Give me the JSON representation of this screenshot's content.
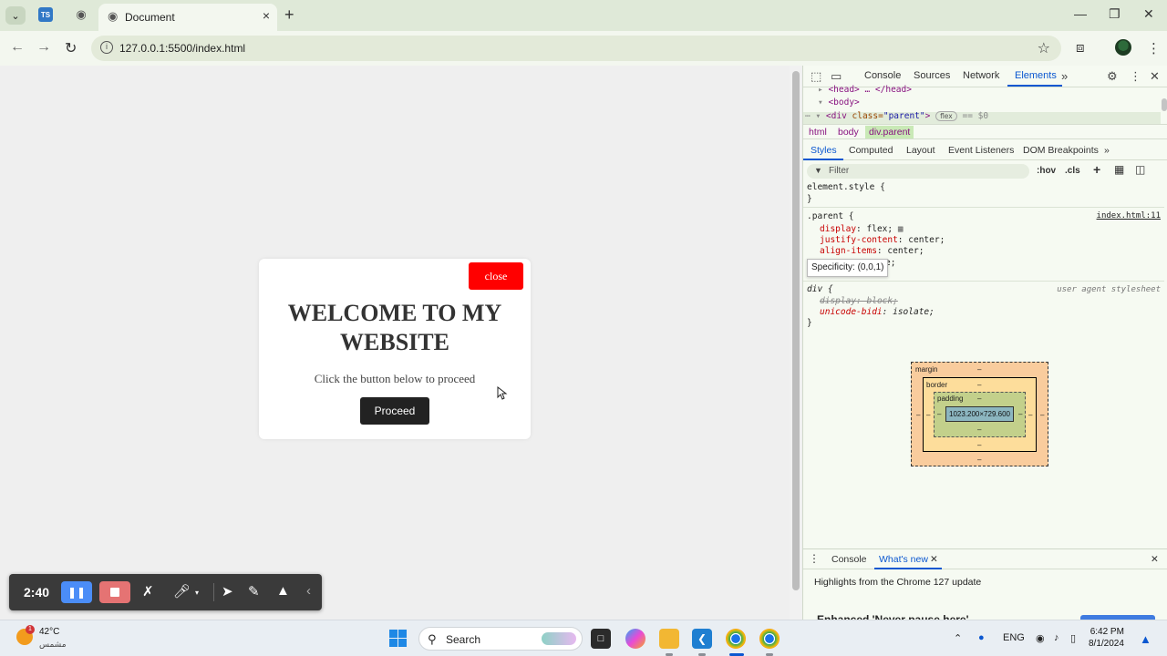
{
  "browser": {
    "tab_title": "Document",
    "url": "127.0.0.1:5500/index.html",
    "pinned_ts_label": "TS",
    "icons": {
      "tab_search": "chevron-down-icon",
      "close": "close-icon",
      "new_tab": "plus-icon"
    }
  },
  "page": {
    "close_label": "close",
    "heading": "WELCOME TO MY WEBSITE",
    "subtext": "Click the button below to proceed",
    "proceed_label": "Proceed",
    "colors": {
      "close_bg": "#ff0000",
      "proceed_bg": "#222222",
      "viewport_bg": "#efefef"
    }
  },
  "recorder": {
    "time": "2:40",
    "icons": [
      "pause-icon",
      "stop-icon",
      "pen-off-icon",
      "mic-icon",
      "pointer-icon",
      "pencil-icon",
      "eraser-icon",
      "chevron-left-icon"
    ]
  },
  "devtools": {
    "tabs": [
      "Console",
      "Sources",
      "Network",
      "Elements"
    ],
    "active_tab": "Elements",
    "dom": {
      "head_line": "<head> … </head>",
      "body_line": "<body>",
      "div_tag_open": "<div ",
      "div_attr": "class=",
      "div_val": "\"parent\"",
      "div_close": ">",
      "flex_badge": "flex",
      "dollar": "== $0"
    },
    "breadcrumbs": [
      "html",
      "body",
      "div.parent"
    ],
    "subtabs": [
      "Styles",
      "Computed",
      "Layout",
      "Event Listeners",
      "DOM Breakpoints"
    ],
    "filter_placeholder": "Filter",
    "filter_tools": [
      ":hov",
      ".cls"
    ],
    "styles": {
      "element_style": "element.style {",
      "brace_close": "}",
      "parent_selector": ".parent {",
      "parent_source": "index.html:11",
      "parent_props": [
        {
          "name": "display",
          "value": "flex;"
        },
        {
          "name": "justify-content",
          "value": "center;"
        },
        {
          "name": "align-items",
          "value": "center;"
        }
      ],
      "hidden_tail": "e;",
      "specificity": "Specificity: (0,0,1)",
      "div_selector": "div {",
      "ua_source": "user agent stylesheet",
      "div_props": [
        {
          "name": "display",
          "value": "block;",
          "struck": true
        },
        {
          "name": "unicode-bidi",
          "value": "isolate;",
          "struck": false
        }
      ]
    },
    "box_model": {
      "margin_label": "margin",
      "border_label": "border",
      "padding_label": "padding",
      "content_size": "1023.200×729.600",
      "dash": "–"
    },
    "drawer": {
      "tabs": [
        "Console",
        "What's new"
      ],
      "active_tab": "What's new",
      "highlight": "Highlights from the Chrome 127 update",
      "heading": "Enhanced 'Never pause here'"
    }
  },
  "taskbar": {
    "weather_temp": "42°C",
    "weather_desc": "مشمس",
    "weather_badge": "1",
    "search_label": "Search",
    "language": "ENG",
    "time": "6:42 PM",
    "date": "8/1/2024"
  }
}
